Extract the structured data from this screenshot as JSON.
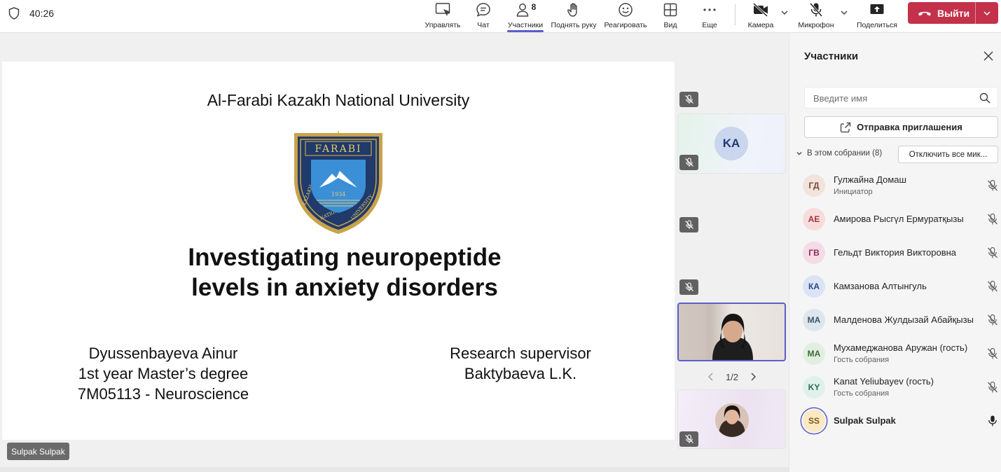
{
  "topbar": {
    "timer": "40:26",
    "buttons": [
      {
        "id": "control",
        "label": "Управлять"
      },
      {
        "id": "chat",
        "label": "Чат"
      },
      {
        "id": "participants",
        "label": "Участники",
        "badge": "8"
      },
      {
        "id": "raise-hand",
        "label": "Поднять руку"
      },
      {
        "id": "react",
        "label": "Реагировать"
      },
      {
        "id": "view",
        "label": "Вид"
      },
      {
        "id": "more",
        "label": "Еще"
      },
      {
        "id": "camera",
        "label": "Камера"
      },
      {
        "id": "mic",
        "label": "Микрофон"
      },
      {
        "id": "share",
        "label": "Поделиться"
      }
    ],
    "leave_label": "Выйти",
    "accent_color": "#5b5fc7",
    "leave_color": "#c4314b"
  },
  "slide": {
    "university": "Al-Farabi Kazakh National University",
    "logo": {
      "top_text": "FARABI",
      "ring_text": "KAZAKH NATIONAL UNIVERSITY",
      "year": "1934"
    },
    "title_line1": "Investigating neuropeptide",
    "title_line2": "levels in anxiety disorders",
    "author": [
      "Dyussenbayeva Ainur",
      "1st year Master’s degree",
      "7M05113 - Neuroscience"
    ],
    "supervisor": [
      "Research supervisor",
      "Baktybaeva L.K."
    ]
  },
  "presenter_tag": "Sulpak Sulpak",
  "gallery": {
    "ka_tile_initials": "KA",
    "page": "1/2"
  },
  "panel": {
    "title": "Участники",
    "search_placeholder": "Введите имя",
    "invite_label": "Отправка приглашения",
    "section_label": "В этом собрании (8)",
    "mute_all_label": "Отключить все мик...",
    "participants": [
      {
        "initials": "ГД",
        "name": "Гулжайна Домаш",
        "role": "Инициатор",
        "avatar_bg": "#f2e3dc",
        "avatar_fg": "#7a4a3a",
        "mic": "muted"
      },
      {
        "initials": "АЕ",
        "name": "Амирова Рысгүл Ермуратқызы",
        "role": "",
        "avatar_bg": "#f8dcdc",
        "avatar_fg": "#a3333d",
        "mic": "muted"
      },
      {
        "initials": "ГВ",
        "name": "Гельдт Виктория Викторовна",
        "role": "",
        "avatar_bg": "#f4dbe6",
        "avatar_fg": "#8a2f5a",
        "mic": "muted"
      },
      {
        "initials": "КА",
        "name": "Камзанова Алтынгуль",
        "role": "",
        "avatar_bg": "#dbe4f5",
        "avatar_fg": "#2b4a86",
        "mic": "muted"
      },
      {
        "initials": "МА",
        "name": "Малденова Жулдызай Абайқызы",
        "role": "",
        "avatar_bg": "#dde6ec",
        "avatar_fg": "#37566b",
        "mic": "muted"
      },
      {
        "initials": "МА",
        "name": "Мухамеджанова Аружан (гость)",
        "role": "Гость собрания",
        "avatar_bg": "#e1efe0",
        "avatar_fg": "#3f6b3b",
        "mic": "muted"
      },
      {
        "initials": "KY",
        "name": "Kanat Yeliubayev (гость)",
        "role": "Гость собрания",
        "avatar_bg": "#dff1ea",
        "avatar_fg": "#2e6b56",
        "mic": "muted"
      },
      {
        "initials": "SS",
        "name": "Sulpak Sulpak",
        "role": "",
        "avatar_bg": "#fbe9c4",
        "avatar_fg": "#7a5a14",
        "mic": "on"
      }
    ]
  }
}
